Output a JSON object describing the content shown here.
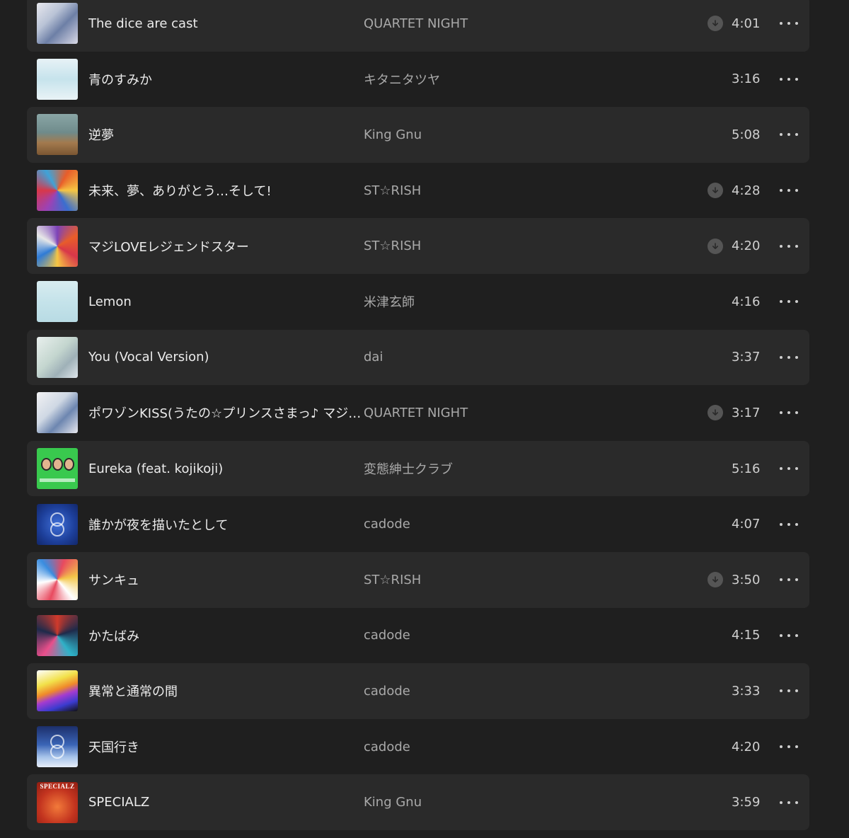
{
  "tracks": [
    {
      "title": "The dice are cast",
      "artist": "QUARTET NIGHT",
      "duration": "4:01",
      "downloaded": true
    },
    {
      "title": "青のすみか",
      "artist": "キタニタツヤ",
      "duration": "3:16",
      "downloaded": false
    },
    {
      "title": "逆夢",
      "artist": "King Gnu",
      "duration": "5:08",
      "downloaded": false
    },
    {
      "title": "未来、夢、ありがとう…そして!",
      "artist": "ST☆RISH",
      "duration": "4:28",
      "downloaded": true
    },
    {
      "title": "マジLOVEレジェンドスター",
      "artist": "ST☆RISH",
      "duration": "4:20",
      "downloaded": true
    },
    {
      "title": "Lemon",
      "artist": "米津玄師",
      "duration": "4:16",
      "downloaded": false
    },
    {
      "title": "You (Vocal Version)",
      "artist": "dai",
      "duration": "3:37",
      "downloaded": false
    },
    {
      "title": "ポワゾンKISS(うたの☆プリンスさまっ♪ マジLO…",
      "artist": "QUARTET NIGHT",
      "duration": "3:17",
      "downloaded": true
    },
    {
      "title": "Eureka (feat. kojikoji)",
      "artist": "変態紳士クラブ",
      "duration": "5:16",
      "downloaded": false
    },
    {
      "title": "誰かが夜を描いたとして",
      "artist": "cadode",
      "duration": "4:07",
      "downloaded": false
    },
    {
      "title": "サンキュ",
      "artist": "ST☆RISH",
      "duration": "3:50",
      "downloaded": true
    },
    {
      "title": "かたばみ",
      "artist": "cadode",
      "duration": "4:15",
      "downloaded": false
    },
    {
      "title": "異常と通常の間",
      "artist": "cadode",
      "duration": "3:33",
      "downloaded": false
    },
    {
      "title": "天国行き",
      "artist": "cadode",
      "duration": "4:20",
      "downloaded": false
    },
    {
      "title": "SPECIALZ",
      "artist": "King Gnu",
      "duration": "3:59",
      "downloaded": false
    }
  ],
  "album_art": {
    "specialz_text": "SPECIALZ"
  },
  "icons": {
    "download": "download-arrow-circle-icon",
    "more": "more-ellipsis-icon"
  },
  "colors": {
    "background": "#1f1f1f",
    "row_alt": "#2a2a2a",
    "title": "#ececec",
    "artist": "#a9a9a9"
  }
}
